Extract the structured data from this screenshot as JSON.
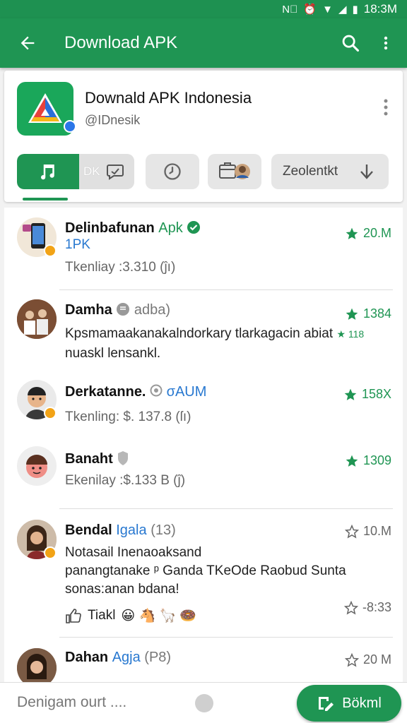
{
  "status_bar": {
    "time": "18:3M"
  },
  "app_bar": {
    "title": "Download APK",
    "back_icon": "arrow-left-icon",
    "search_icon": "search-icon",
    "more_icon": "more-vert-icon"
  },
  "header": {
    "app_name": "Downald APK Indonesia",
    "handle": "@IDnesik",
    "tabs": {
      "main_label": "DK",
      "search_label": "Zeolentkt"
    }
  },
  "list": {
    "items": [
      {
        "name": "Delinbafunan",
        "name_suffix": "Apk",
        "line1": "1PK",
        "line2": "Tkenliay :3.310 (ĵı)",
        "rating": "20.M"
      },
      {
        "name": "Damha",
        "name_suffix": "adba)",
        "line1": "Kpsmamaakanakalndorkary tlarkagacin abiat",
        "line1_extra": "★ 118",
        "line2": "nuaskl lensankl.",
        "rating": "1384"
      },
      {
        "name": "Derkatanne.",
        "name_suffix": "σAUM",
        "line1": "Tkenling: $. 137.8 (ſı)",
        "rating": "158X"
      },
      {
        "name": "Banaht",
        "name_suffix": "",
        "line1": "Ekenilay :$.133 B (ĵ)",
        "rating": "1309"
      },
      {
        "name": "Bendal",
        "name_suffix": "Igala",
        "name_suffix2": "(13)",
        "line1": "Notasail Inenaoaksand",
        "line2": "panangtanake ᵖ Ganda TKeOde Raobud Sunta",
        "line3": "sonas:anan bdana!",
        "action_label": "Tiakl",
        "action_emojis": "😀 🐴 🦙 🍩",
        "rating": "10.M",
        "rating2": "-8:33"
      },
      {
        "name": "Dahan",
        "name_suffix": "Agja",
        "name_suffix2": "(P8)",
        "rating": "20 M"
      }
    ]
  },
  "bottom_bar": {
    "input_text": "Denigam ourt ....",
    "fab_label": "Bökml"
  },
  "colors": {
    "primary": "#1f9553",
    "accent_blue": "#2878d0",
    "star_green": "#1f9553"
  }
}
